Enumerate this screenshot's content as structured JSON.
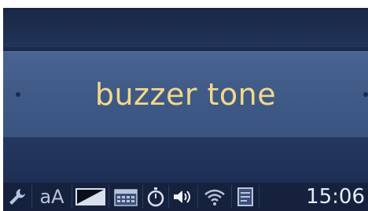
{
  "menu": {
    "selected_label": "buzzer tone"
  },
  "status_bar": {
    "icons": [
      "wrench-icon",
      "font-size-icon",
      "contrast-icon",
      "calendar-icon",
      "stopwatch-icon",
      "speaker-icon",
      "wifi-icon",
      "notes-icon"
    ],
    "font_size_label": "aA",
    "time": "15:06"
  },
  "colors": {
    "screen_bg": "#1b2a49",
    "highlight_bg": "#3f5a86",
    "highlight_text": "#f2d88a",
    "status_text": "#e6ecf7"
  }
}
